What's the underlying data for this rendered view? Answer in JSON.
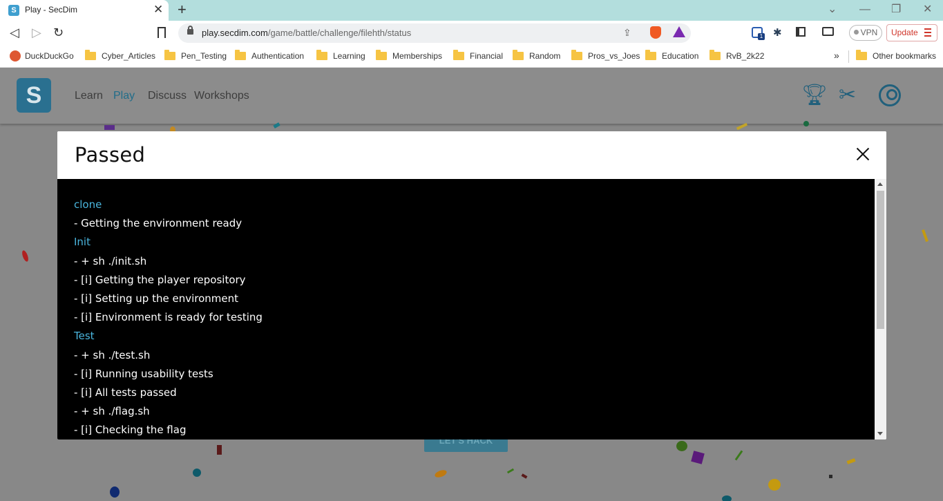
{
  "browser": {
    "tab_title": "Play - SecDim",
    "tab_favicon": "S",
    "new_tab_icon": "plus-icon",
    "url_host": "play.secdim.com",
    "url_path": "/game/battle/challenge/filehth/status",
    "vpn_label": "VPN",
    "update_label": "Update",
    "extension_badge": "1"
  },
  "bookmarks": [
    {
      "label": "DuckDuckGo",
      "icon": "duckduckgo-icon"
    },
    {
      "label": "Cyber_Articles",
      "icon": "folder-icon"
    },
    {
      "label": "Pen_Testing",
      "icon": "folder-icon"
    },
    {
      "label": "Authentication",
      "icon": "folder-icon"
    },
    {
      "label": "Learning",
      "icon": "folder-icon"
    },
    {
      "label": "Memberships",
      "icon": "folder-icon"
    },
    {
      "label": "Financial",
      "icon": "folder-icon"
    },
    {
      "label": "Random",
      "icon": "folder-icon"
    },
    {
      "label": "Pros_vs_Joes",
      "icon": "folder-icon"
    },
    {
      "label": "Education",
      "icon": "folder-icon"
    },
    {
      "label": "RvB_2k22",
      "icon": "folder-icon"
    }
  ],
  "other_bookmarks": "Other bookmarks",
  "site": {
    "logo_letter": "S",
    "nav": [
      {
        "label": "Learn",
        "active": false
      },
      {
        "label": "Play",
        "active": true
      },
      {
        "label": "Discuss",
        "active": false
      },
      {
        "label": "Workshops",
        "active": false
      }
    ],
    "hack_button": "LET'S HACK",
    "accent_color": "#4ab5dd"
  },
  "modal": {
    "title": "Passed",
    "lines": [
      {
        "text": "clone",
        "type": "stage"
      },
      {
        "text": "- Getting the environment ready",
        "type": "log"
      },
      {
        "text": "Init",
        "type": "stage"
      },
      {
        "text": "- + sh ./init.sh",
        "type": "log"
      },
      {
        "text": "- [i] Getting the player repository",
        "type": "log"
      },
      {
        "text": "- [i] Setting up the environment",
        "type": "log"
      },
      {
        "text": "- [i] Environment is ready for testing",
        "type": "log"
      },
      {
        "text": "Test",
        "type": "stage"
      },
      {
        "text": "- + sh ./test.sh",
        "type": "log"
      },
      {
        "text": "- [i] Running usability tests",
        "type": "log"
      },
      {
        "text": "- [i] All tests passed",
        "type": "log"
      },
      {
        "text": "- + sh ./flag.sh",
        "type": "log"
      },
      {
        "text": "- [i] Checking the flag",
        "type": "log"
      }
    ]
  }
}
